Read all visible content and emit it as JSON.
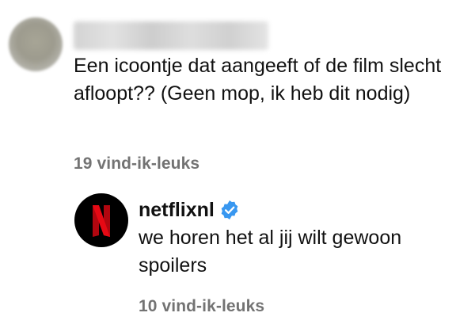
{
  "comment": {
    "text": "Een icoontje dat aangeeft of de film slecht afloopt?? (Geen mop, ik heb dit nodig)",
    "likes": "19 vind-ik-leuks"
  },
  "reply": {
    "username": "netflixnl",
    "text": "we horen het al jij wilt gewoon spoilers",
    "likes": "10 vind-ik-leuks",
    "avatar_icon": "netflix-n-logo",
    "badge_icon": "verified-badge-icon"
  },
  "colors": {
    "text": "#111111",
    "secondary": "#737373",
    "verified": "#3897f0",
    "netflix_red": "#e50914"
  }
}
